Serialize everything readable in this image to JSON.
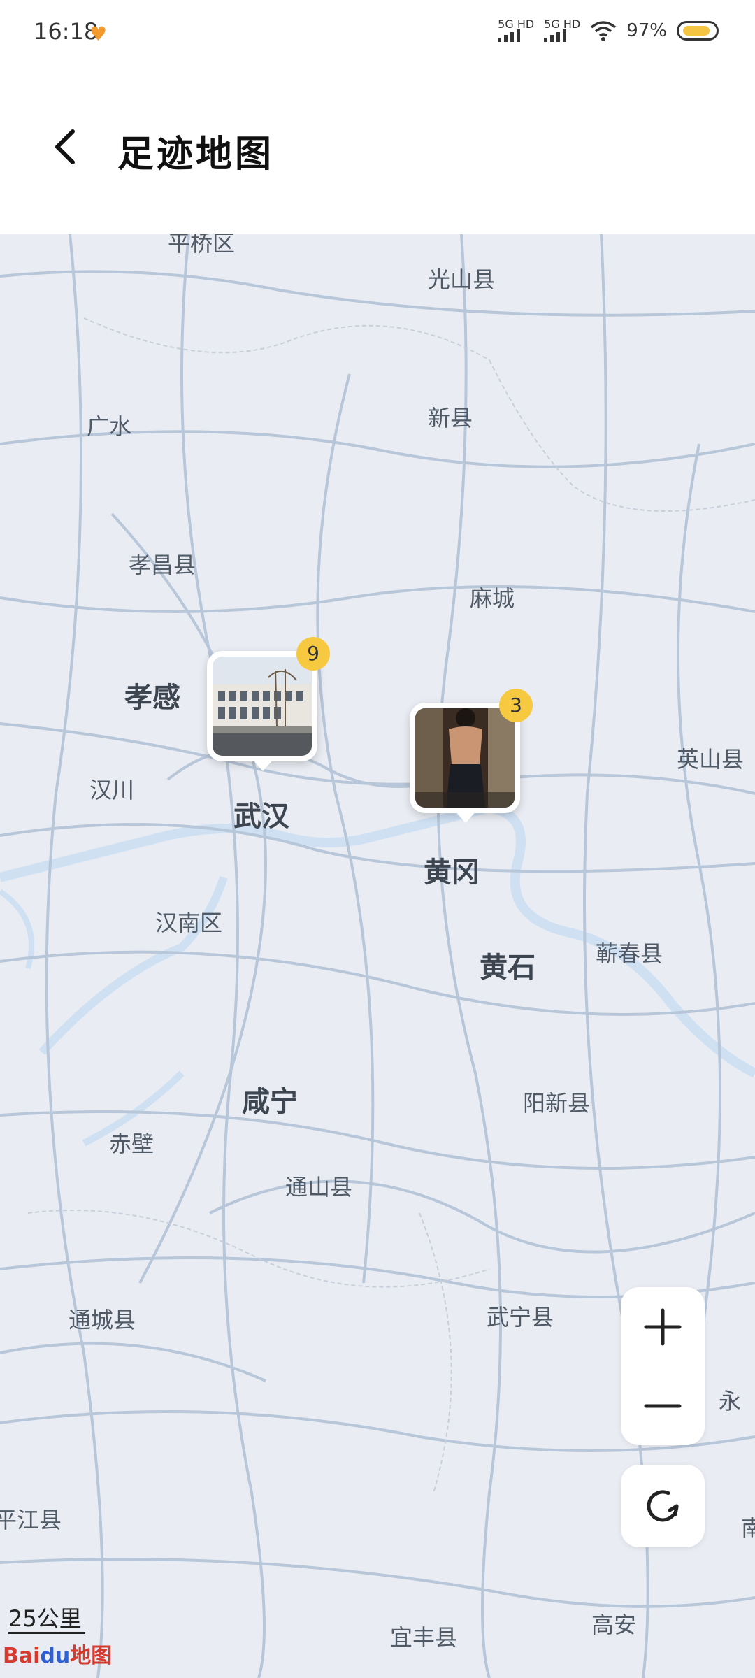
{
  "status_bar": {
    "time": "16:18",
    "network_1": "5G HD",
    "network_2": "5G HD",
    "battery": "97%"
  },
  "header": {
    "title": "足迹地图"
  },
  "map": {
    "places": [
      {
        "name": "平桥区",
        "kind": "small"
      },
      {
        "name": "光山县",
        "kind": "small"
      },
      {
        "name": "新县",
        "kind": "small"
      },
      {
        "name": "广水",
        "kind": "small"
      },
      {
        "name": "孝昌县",
        "kind": "small"
      },
      {
        "name": "麻城",
        "kind": "small"
      },
      {
        "name": "孝感",
        "kind": "big"
      },
      {
        "name": "英山县",
        "kind": "small"
      },
      {
        "name": "汉川",
        "kind": "small"
      },
      {
        "name": "武汉",
        "kind": "big"
      },
      {
        "name": "黄冈",
        "kind": "big"
      },
      {
        "name": "汉南区",
        "kind": "small"
      },
      {
        "name": "黄石",
        "kind": "big"
      },
      {
        "name": "蕲春县",
        "kind": "small"
      },
      {
        "name": "咸宁",
        "kind": "big"
      },
      {
        "name": "阳新县",
        "kind": "small"
      },
      {
        "name": "赤壁",
        "kind": "small"
      },
      {
        "name": "通山县",
        "kind": "small"
      },
      {
        "name": "通城县",
        "kind": "small"
      },
      {
        "name": "武宁县",
        "kind": "small"
      },
      {
        "name": "永",
        "kind": "small"
      },
      {
        "name": "平江县",
        "kind": "small"
      },
      {
        "name": "南",
        "kind": "small"
      },
      {
        "name": "宜丰县",
        "kind": "small"
      },
      {
        "name": "高安",
        "kind": "small"
      }
    ],
    "pins": [
      {
        "location": "武汉",
        "count": "9",
        "photo": "building-photo"
      },
      {
        "location": "黄冈",
        "count": "3",
        "photo": "person-photo"
      }
    ],
    "scale_label": "25公里",
    "logo_text_1": "Bai",
    "logo_text_2": "du",
    "logo_text_3": "地图",
    "colors": {
      "map_bg": "#e9edf3",
      "road": "#b8c6d9",
      "water": "#cfe0f3",
      "badge": "#f6c940"
    }
  },
  "controls": {
    "zoom_in_icon": "plus-icon",
    "zoom_out_icon": "minus-icon",
    "reset_icon": "refresh-icon"
  }
}
